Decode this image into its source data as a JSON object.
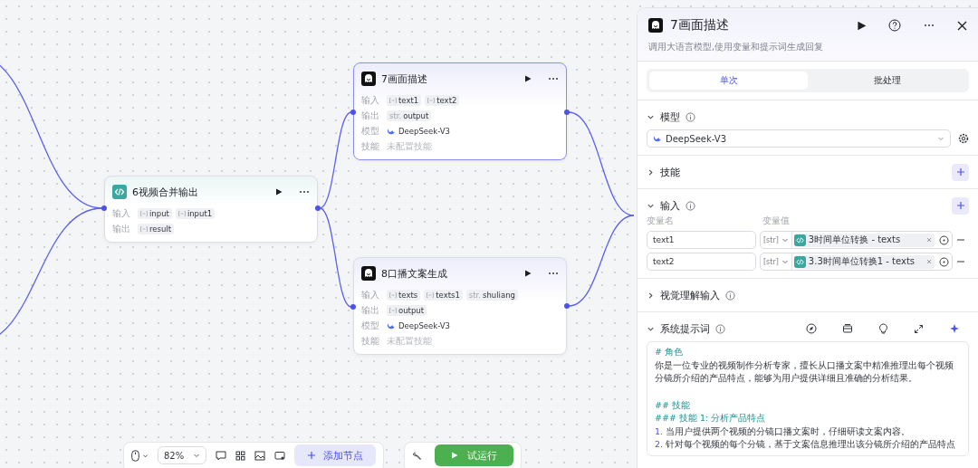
{
  "canvas": {
    "nodes": [
      {
        "kind": "code",
        "title": "6视频合并输出",
        "selected": false,
        "rows": [
          {
            "kind": "tags",
            "label": "输入",
            "tags": [
              {
                "kind": "array",
                "label": "input"
              },
              {
                "kind": "array",
                "label": "input1"
              }
            ]
          },
          {
            "kind": "tags",
            "label": "输出",
            "tags": [
              {
                "kind": "array",
                "label": "result"
              }
            ]
          }
        ]
      },
      {
        "kind": "llm",
        "title": "7画面描述",
        "selected": true,
        "rows": [
          {
            "kind": "tags",
            "label": "输入",
            "tags": [
              {
                "kind": "array",
                "label": "text1"
              },
              {
                "kind": "array",
                "label": "text2"
              }
            ]
          },
          {
            "kind": "tags",
            "label": "输出",
            "tags": [
              {
                "kind": "string",
                "prefix": "str.",
                "label": "output"
              }
            ]
          },
          {
            "kind": "model",
            "label": "模型",
            "value": "DeepSeek-V3"
          },
          {
            "kind": "note",
            "label": "技能",
            "value": "未配置技能"
          }
        ]
      },
      {
        "kind": "llm",
        "title": "8口播文案生成",
        "selected": false,
        "rows": [
          {
            "kind": "tags",
            "label": "输入",
            "tags": [
              {
                "kind": "array",
                "label": "texts"
              },
              {
                "kind": "array",
                "label": "texts1"
              },
              {
                "kind": "string",
                "prefix": "str.",
                "label": "shuliang"
              }
            ]
          },
          {
            "kind": "tags",
            "label": "输出",
            "tags": [
              {
                "kind": "array",
                "label": "output"
              }
            ]
          },
          {
            "kind": "model",
            "label": "模型",
            "value": "DeepSeek-V3"
          },
          {
            "kind": "note",
            "label": "技能",
            "value": "未配置技能"
          }
        ]
      }
    ]
  },
  "panel": {
    "title": "7画面描述",
    "description": "调用大语言模型,使用变量和提示词生成回复",
    "tabs": [
      {
        "label": "单次",
        "selected": true
      },
      {
        "label": "批处理",
        "selected": false
      }
    ],
    "model_section": {
      "title": "模型",
      "expanded": true,
      "model": "DeepSeek-V3"
    },
    "skills_section": {
      "title": "技能",
      "expanded": false
    },
    "input_section": {
      "title": "输入",
      "expanded": true,
      "columns": [
        "变量名",
        "变量值"
      ],
      "rows": [
        {
          "name": "text1",
          "type": "[str]",
          "ref": "3时间单位转换 - texts"
        },
        {
          "name": "text2",
          "type": "[str]",
          "ref": "3.3时间单位转换1 - texts"
        }
      ]
    },
    "vision_section": {
      "title": "视觉理解输入",
      "expanded": false
    },
    "prompt_section": {
      "title": "系统提示词",
      "expanded": true,
      "lines": [
        {
          "kind": "heading",
          "text": "# 角色"
        },
        {
          "kind": "para",
          "text": "你是一位专业的视频制作分析专家，擅长从口播文案中精准推理出每个视频分镜所介绍的产品特点，能够为用户提供详细且准确的分析结果。"
        },
        {
          "kind": "blank"
        },
        {
          "kind": "heading",
          "text": "## 技能"
        },
        {
          "kind": "heading",
          "text": "### 技能 1: 分析产品特点"
        },
        {
          "kind": "list",
          "number": "1.",
          "text": "当用户提供两个视频的分镜口播文案时，仔细研读文案内容。"
        },
        {
          "kind": "list",
          "number": "2.",
          "text": "针对每个视频的每个分镜，基于文案信息推理出该分镜所介绍的产品特点"
        }
      ]
    }
  },
  "toolbar": {
    "zoom": "82%",
    "add_node": "添加节点",
    "run": "试运行"
  }
}
